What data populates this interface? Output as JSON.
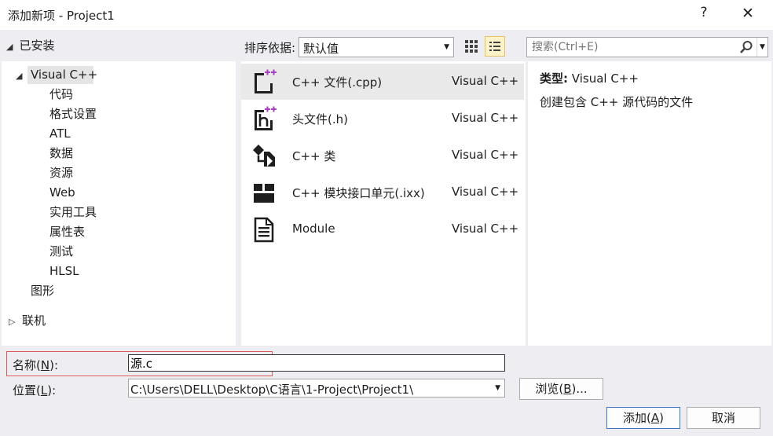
{
  "window": {
    "title": "添加新项 - Project1",
    "help_glyph": "?",
    "close_glyph": "✕"
  },
  "left": {
    "installed_label": "已安装",
    "tree": {
      "root_label": "Visual C++",
      "children": [
        "代码",
        "格式设置",
        "ATL",
        "数据",
        "资源",
        "Web",
        "实用工具",
        "属性表",
        "测试",
        "HLSL"
      ],
      "graphics_label": "图形"
    },
    "online_label": "联机"
  },
  "toolbar": {
    "sort_label": "排序依据:",
    "sort_value": "默认值",
    "search_placeholder": "搜索(Ctrl+E)"
  },
  "templates": [
    {
      "name": "C++ 文件(.cpp)",
      "lang": "Visual C++",
      "icon": "cpp-file-icon",
      "selected": true
    },
    {
      "name": "头文件(.h)",
      "lang": "Visual C++",
      "icon": "header-file-icon",
      "selected": false
    },
    {
      "name": "C++ 类",
      "lang": "Visual C++",
      "icon": "cpp-class-icon",
      "selected": false
    },
    {
      "name": "C++ 模块接口单元(.ixx)",
      "lang": "Visual C++",
      "icon": "module-interface-icon",
      "selected": false
    },
    {
      "name": "Module",
      "lang": "Visual C++",
      "icon": "module-document-icon",
      "selected": false
    }
  ],
  "description": {
    "type_label": "类型:",
    "type_value": "Visual C++",
    "text": "创建包含 C++ 源代码的文件"
  },
  "form": {
    "name_label_prefix": "名称(",
    "name_label_key": "N",
    "name_label_suffix": "):",
    "name_value": "源.c",
    "location_label_prefix": "位置(",
    "location_label_key": "L",
    "location_label_suffix": "):",
    "location_value": "C:\\Users\\DELL\\Desktop\\C语言\\1-Project\\Project1\\",
    "browse_prefix": "浏览(",
    "browse_key": "B",
    "browse_suffix": ")...",
    "add_prefix": "添加(",
    "add_key": "A",
    "add_suffix": ")",
    "cancel_label": "取消"
  },
  "colors": {
    "accent_purple": "#a83ec2",
    "selection_gray": "#e9e9e9",
    "highlight_red": "#e05a5a"
  }
}
